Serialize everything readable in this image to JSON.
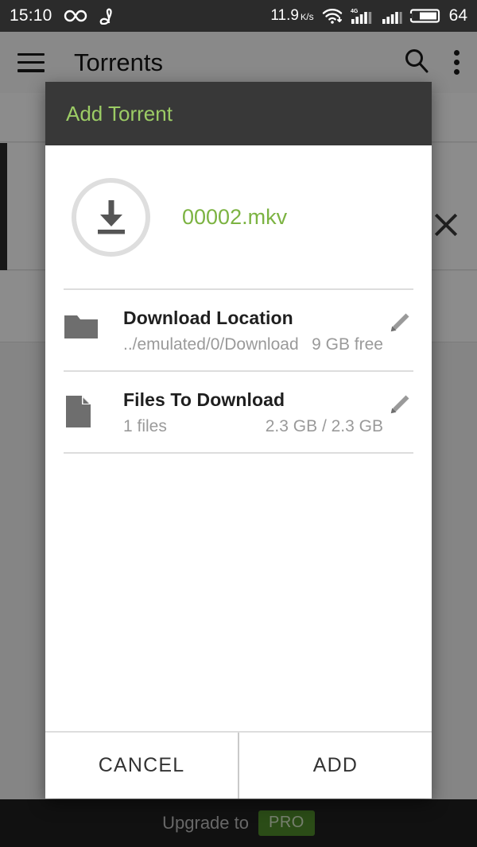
{
  "statusbar": {
    "clock": "15:10",
    "icons_left": [
      "infinity-icon",
      "data-saver-icon"
    ],
    "data_rate": "11.9",
    "data_rate_unit_num": "K",
    "data_rate_unit_den": "s",
    "icons_right": [
      "wifi-download-icon",
      "signal-4g-icon",
      "signal-icon"
    ],
    "battery_level": "64",
    "background_color": "#2b2b2b"
  },
  "appbar": {
    "title": "Torrents",
    "menu_icon": "hamburger-menu-icon",
    "search_icon": "search-icon",
    "overflow_icon": "kebab-menu-icon"
  },
  "background": {
    "close_icon": "close-icon"
  },
  "upgrade": {
    "text": "Upgrade to",
    "badge": "PRO",
    "badge_color": "#4f8a2b"
  },
  "dialog": {
    "title": "Add Torrent",
    "title_color": "#9ccc65",
    "header_color": "#383838",
    "torrent": {
      "icon": "download-circle-icon",
      "name": "00002.mkv",
      "name_color": "#7cb342"
    },
    "rows": [
      {
        "icon": "folder-icon",
        "title": "Download Location",
        "sub_left": "../emulated/0/Download",
        "sub_right": "9 GB free",
        "edit_icon": "pencil-edit-icon"
      },
      {
        "icon": "file-document-icon",
        "title": "Files To Download",
        "sub_left": "1 files",
        "sub_right": "2.3 GB / 2.3 GB",
        "edit_icon": "pencil-edit-icon"
      }
    ],
    "actions": {
      "cancel": "CANCEL",
      "add": "ADD"
    }
  }
}
